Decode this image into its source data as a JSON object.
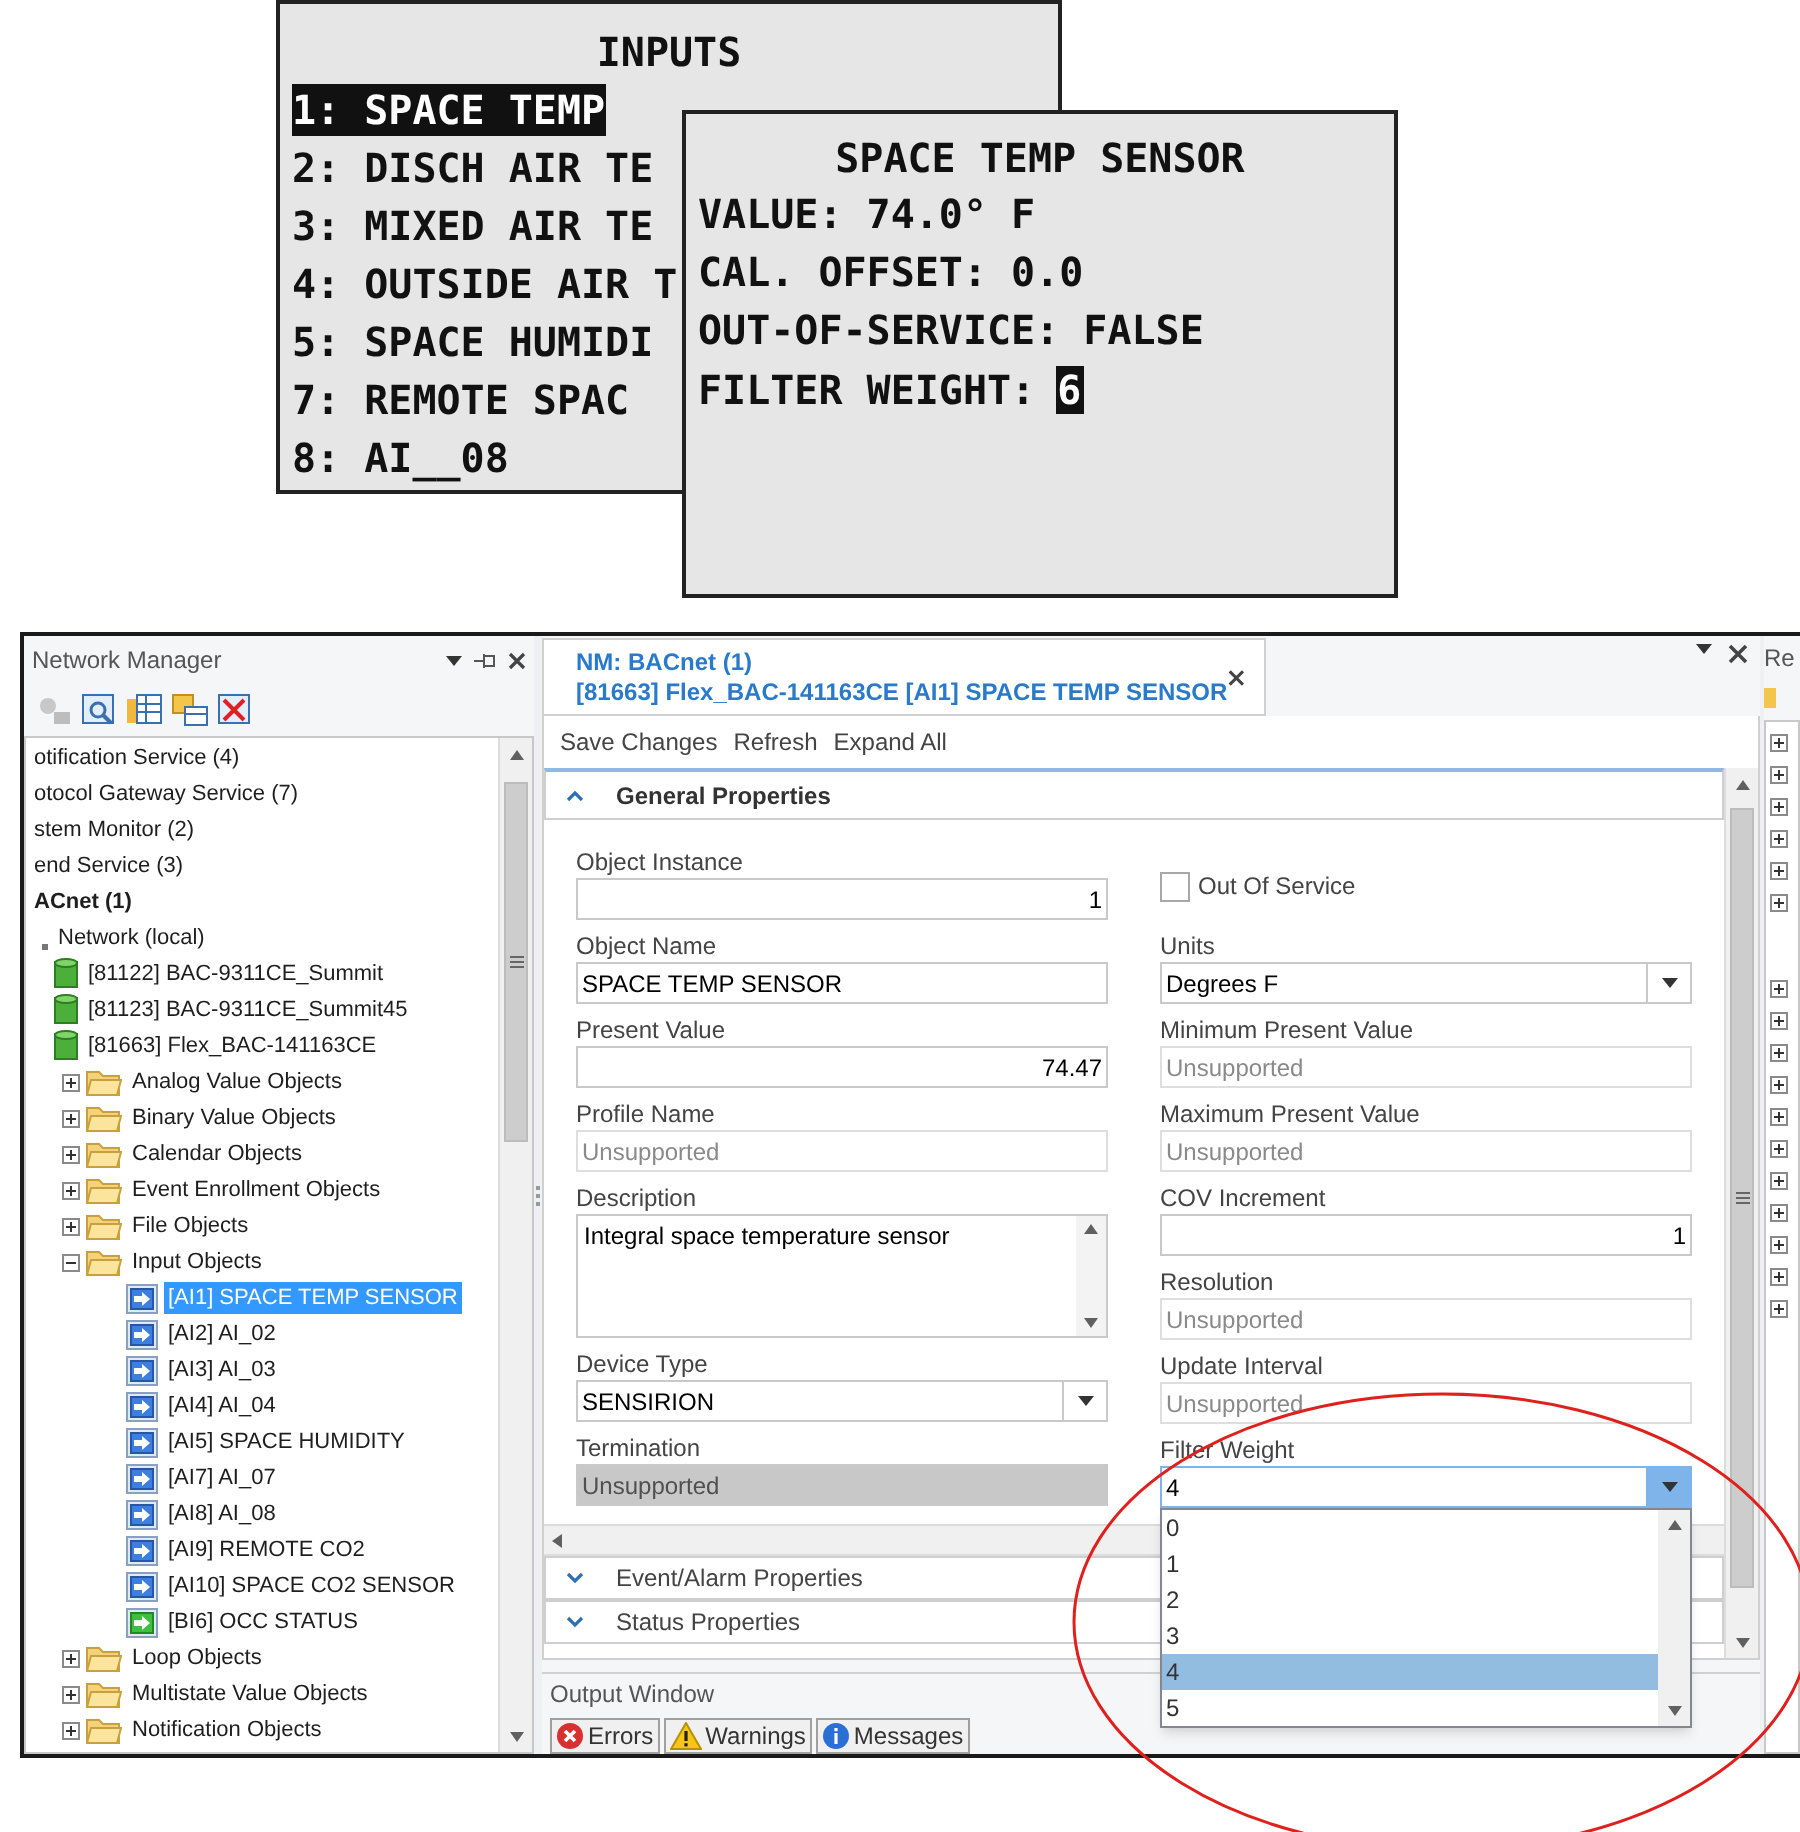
{
  "lcd_menu": {
    "title": "INPUTS",
    "items": [
      {
        "label": "1: SPACE TEMP",
        "selected": true
      },
      {
        "label": "2: DISCH AIR TE",
        "selected": false
      },
      {
        "label": "3: MIXED AIR TE",
        "selected": false
      },
      {
        "label": "4: OUTSIDE AIR T",
        "selected": false
      },
      {
        "label": "5: SPACE HUMIDI",
        "selected": false
      },
      {
        "label": "7: REMOTE SPAC",
        "selected": false
      },
      {
        "label": "8: AI__08",
        "selected": false
      }
    ]
  },
  "lcd_detail": {
    "title": "SPACE TEMP SENSOR",
    "lines": [
      "VALUE: 74.0° F",
      "CAL. OFFSET: 0.0",
      "OUT-OF-SERVICE: FALSE"
    ],
    "edit_label": "FILTER WEIGHT:",
    "cursor_value": "6"
  },
  "network_manager": {
    "title": "Network Manager",
    "tree": [
      {
        "label": "otification Service (4)",
        "kind": "service",
        "selected": false
      },
      {
        "label": "otocol Gateway Service (7)",
        "kind": "service",
        "selected": false
      },
      {
        "label": "stem Monitor (2)",
        "kind": "service",
        "selected": false
      },
      {
        "label": "end Service (3)",
        "kind": "service",
        "selected": false
      },
      {
        "label": "ACnet (1)",
        "kind": "protocol",
        "selected": false,
        "children": [
          {
            "label": "Network (local)",
            "kind": "network",
            "selected": false,
            "children": [
              {
                "label": "[81122] BAC-9311CE_Summit",
                "kind": "device",
                "selected": false
              },
              {
                "label": "[81123] BAC-9311CE_Summit45",
                "kind": "device",
                "selected": false
              },
              {
                "label": "[81663] Flex_BAC-141163CE",
                "kind": "device",
                "selected": false,
                "children": [
                  {
                    "label": "Analog Value Objects",
                    "kind": "folder",
                    "expanded": false,
                    "selected": false
                  },
                  {
                    "label": "Binary Value Objects",
                    "kind": "folder",
                    "expanded": false,
                    "selected": false
                  },
                  {
                    "label": "Calendar Objects",
                    "kind": "folder",
                    "expanded": false,
                    "selected": false
                  },
                  {
                    "label": "Event Enrollment Objects",
                    "kind": "folder",
                    "expanded": false,
                    "selected": false
                  },
                  {
                    "label": "File Objects",
                    "kind": "folder",
                    "expanded": false,
                    "selected": false
                  },
                  {
                    "label": "Input Objects",
                    "kind": "folder",
                    "expanded": true,
                    "selected": false,
                    "children": [
                      {
                        "label": "[AI1] SPACE TEMP SENSOR",
                        "kind": "analog-input",
                        "selected": true
                      },
                      {
                        "label": "[AI2] AI_02",
                        "kind": "analog-input",
                        "selected": false
                      },
                      {
                        "label": "[AI3] AI_03",
                        "kind": "analog-input",
                        "selected": false
                      },
                      {
                        "label": "[AI4] AI_04",
                        "kind": "analog-input",
                        "selected": false
                      },
                      {
                        "label": "[AI5] SPACE HUMIDITY",
                        "kind": "analog-input",
                        "selected": false
                      },
                      {
                        "label": "[AI7] AI_07",
                        "kind": "analog-input",
                        "selected": false
                      },
                      {
                        "label": "[AI8] AI_08",
                        "kind": "analog-input",
                        "selected": false
                      },
                      {
                        "label": "[AI9] REMOTE CO2",
                        "kind": "analog-input",
                        "selected": false
                      },
                      {
                        "label": "[AI10] SPACE CO2 SENSOR",
                        "kind": "analog-input",
                        "selected": false
                      },
                      {
                        "label": "[BI6] OCC STATUS",
                        "kind": "binary-input",
                        "selected": false
                      }
                    ]
                  },
                  {
                    "label": "Loop Objects",
                    "kind": "folder",
                    "expanded": false,
                    "selected": false
                  },
                  {
                    "label": "Multistate Value Objects",
                    "kind": "folder",
                    "expanded": false,
                    "selected": false
                  },
                  {
                    "label": "Notification Objects",
                    "kind": "folder",
                    "expanded": false,
                    "selected": false
                  }
                ]
              }
            ]
          }
        ]
      }
    ]
  },
  "document": {
    "tab_title": "NM: BACnet (1)",
    "tab_subtitle": "[81663] Flex_BAC-141163CE [AI1] SPACE TEMP SENSOR",
    "toolbar": [
      "Save Changes",
      "Refresh",
      "Expand All"
    ],
    "sections": [
      {
        "title": "General Properties",
        "expanded": true
      },
      {
        "title": "Event/Alarm Properties",
        "expanded": false
      },
      {
        "title": "Status Properties",
        "expanded": false
      }
    ],
    "left_fields": [
      {
        "label": "Object Instance",
        "kind": "number",
        "value": "1"
      },
      {
        "label": "Object Name",
        "kind": "text",
        "value": "SPACE TEMP SENSOR"
      },
      {
        "label": "Present Value",
        "kind": "number",
        "value": "74.47"
      },
      {
        "label": "Profile Name",
        "kind": "readonly",
        "value": "Unsupported"
      },
      {
        "label": "Description",
        "kind": "textarea",
        "value": "Integral space temperature sensor"
      },
      {
        "label": "Device Type",
        "kind": "select",
        "value": "SENSIRION"
      },
      {
        "label": "Termination",
        "kind": "disabled",
        "value": "Unsupported"
      }
    ],
    "right_fields": [
      {
        "label": "Out Of Service",
        "kind": "checkbox",
        "checked": false
      },
      {
        "label": "Units",
        "kind": "select",
        "value": "Degrees F"
      },
      {
        "label": "Minimum Present Value",
        "kind": "readonly",
        "value": "Unsupported"
      },
      {
        "label": "Maximum Present Value",
        "kind": "readonly",
        "value": "Unsupported"
      },
      {
        "label": "COV Increment",
        "kind": "number",
        "value": "1"
      },
      {
        "label": "Resolution",
        "kind": "readonly",
        "value": "Unsupported"
      },
      {
        "label": "Update Interval",
        "kind": "readonly",
        "value": "Unsupported"
      },
      {
        "label": "Filter Weight",
        "kind": "select",
        "value": "4",
        "open": true,
        "options": [
          {
            "label": "0",
            "selected": false
          },
          {
            "label": "1",
            "selected": false
          },
          {
            "label": "2",
            "selected": false
          },
          {
            "label": "3",
            "selected": false
          },
          {
            "label": "4",
            "selected": true
          },
          {
            "label": "5",
            "selected": false
          }
        ]
      }
    ]
  },
  "output_window": {
    "title": "Output Window",
    "tabs": [
      {
        "kind": "errors",
        "label": "Errors"
      },
      {
        "kind": "warnings",
        "label": "Warnings"
      },
      {
        "kind": "messages",
        "label": "Messages"
      }
    ]
  },
  "right_panel": {
    "title": "Re"
  }
}
